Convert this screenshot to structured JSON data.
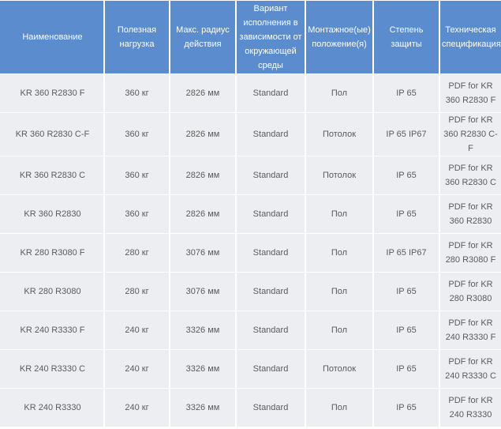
{
  "table": {
    "headers": [
      "Наименование",
      "Полезная нагрузка",
      "Макс. радиус действия",
      "Вариант исполнения в зависимости от окружающей среды",
      "Монтажное(ые) положение(я)",
      "Степень защиты",
      "Техническая спецификация"
    ],
    "rows": [
      [
        "KR 360 R2830 F",
        "360 кг",
        "2826 мм",
        "Standard",
        "Пол",
        "IP 65",
        "PDF for KR 360 R2830 F"
      ],
      [
        "KR 360 R2830 C-F",
        "360 кг",
        "2826 мм",
        "Standard",
        "Потолок",
        "IP 65 IP67",
        "PDF for KR 360 R2830 C-F"
      ],
      [
        "KR 360 R2830 C",
        "360 кг",
        "2826 мм",
        "Standard",
        "Потолок",
        "IP 65",
        "PDF for KR 360 R2830 C"
      ],
      [
        "KR 360 R2830",
        "360 кг",
        "2826 мм",
        "Standard",
        "Пол",
        "IP 65",
        "PDF for KR 360 R2830"
      ],
      [
        "KR 280 R3080 F",
        "280 кг",
        "3076 мм",
        "Standard",
        "Пол",
        "IP 65 IP67",
        "PDF for KR 280 R3080 F"
      ],
      [
        "KR 280 R3080",
        "280 кг",
        "3076 мм",
        "Standard",
        "Пол",
        "IP 65",
        "PDF for KR 280 R3080"
      ],
      [
        "KR 240 R3330 F",
        "240 кг",
        "3326 мм",
        "Standard",
        "Пол",
        "IP 65",
        "PDF for KR 240 R3330 F"
      ],
      [
        "KR 240 R3330 C",
        "240 кг",
        "3326 мм",
        "Standard",
        "Потолок",
        "IP 65",
        "PDF for KR 240 R3330 C"
      ],
      [
        "KR 240 R3330",
        "240 кг",
        "3326 мм",
        "Standard",
        "Пол",
        "IP 65",
        "PDF for KR 240 R3330"
      ]
    ]
  },
  "colors": {
    "header_bg": "#5b8ccd",
    "header_text": "#ffffff",
    "cell_bg": "#eceef1",
    "cell_text": "#5b5b5b"
  }
}
